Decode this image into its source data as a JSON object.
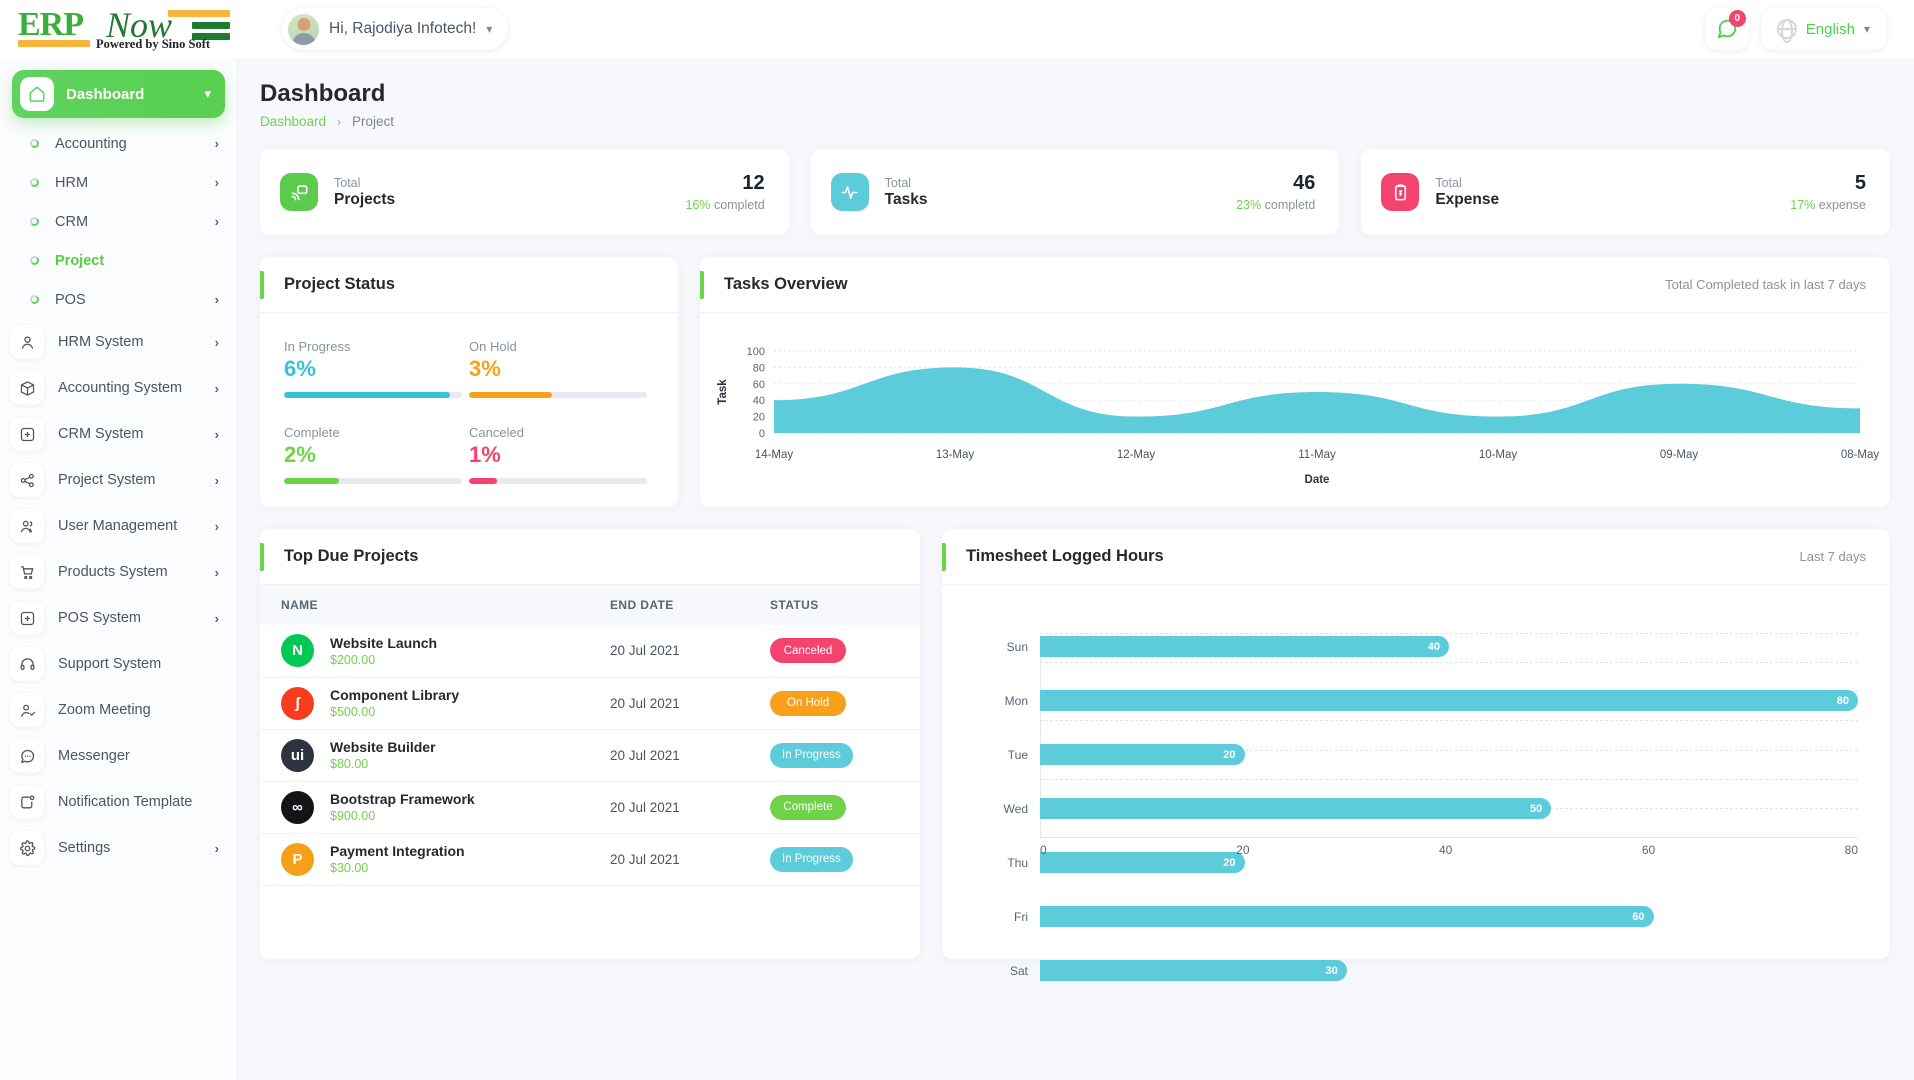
{
  "brand": {
    "erp": "ERP",
    "now": "Now",
    "tagline": "Powered by Sino Soft"
  },
  "topbar": {
    "greeting": "Hi, Rajodiya Infotech!",
    "chevron": "chevron-down",
    "message_badge": "0",
    "language": "English",
    "accent_green": "#4ad04a",
    "badge_color": "#f4436c"
  },
  "sidebar": {
    "dashboard": {
      "label": "Dashboard",
      "icon": "home-icon"
    },
    "sub_items": [
      {
        "label": "Accounting",
        "has_chevron": true,
        "active": false
      },
      {
        "label": "HRM",
        "has_chevron": true,
        "active": false
      },
      {
        "label": "CRM",
        "has_chevron": true,
        "active": false
      },
      {
        "label": "Project",
        "has_chevron": false,
        "active": true
      },
      {
        "label": "POS",
        "has_chevron": true,
        "active": false
      }
    ],
    "items": [
      {
        "label": "HRM System",
        "icon": "user-icon",
        "has_chevron": true
      },
      {
        "label": "Accounting System",
        "icon": "box-icon",
        "has_chevron": true
      },
      {
        "label": "CRM System",
        "icon": "crm-icon",
        "has_chevron": true
      },
      {
        "label": "Project System",
        "icon": "share-icon",
        "has_chevron": true
      },
      {
        "label": "User Management",
        "icon": "users-icon",
        "has_chevron": true
      },
      {
        "label": "Products System",
        "icon": "cart-icon",
        "has_chevron": true
      },
      {
        "label": "POS System",
        "icon": "pos-icon",
        "has_chevron": true
      },
      {
        "label": "Support System",
        "icon": "headset-icon",
        "has_chevron": false
      },
      {
        "label": "Zoom Meeting",
        "icon": "user-check-icon",
        "has_chevron": false
      },
      {
        "label": "Messenger",
        "icon": "chat-icon",
        "has_chevron": false
      },
      {
        "label": "Notification Template",
        "icon": "bell-box-icon",
        "has_chevron": false
      },
      {
        "label": "Settings",
        "icon": "gear-icon",
        "has_chevron": true
      }
    ]
  },
  "page": {
    "title": "Dashboard",
    "breadcrumb": {
      "root": "Dashboard",
      "separator": "›",
      "current": "Project"
    }
  },
  "stats": [
    {
      "total_label": "Total",
      "name": "Projects",
      "value": "12",
      "sub_pct": "16%",
      "sub_text": " completd",
      "color": "#5ccc4f",
      "icon": "cast-icon"
    },
    {
      "total_label": "Total",
      "name": "Tasks",
      "value": "46",
      "sub_pct": "23%",
      "sub_text": " completd",
      "color": "#5cccdb",
      "icon": "activity-icon"
    },
    {
      "total_label": "Total",
      "name": "Expense",
      "value": "5",
      "sub_pct": "17%",
      "sub_text": " expense",
      "color": "#f4436c",
      "icon": "clipboard-dollar-icon"
    }
  ],
  "project_status": {
    "title": "Project Status",
    "cells": [
      {
        "label": "In Progress",
        "pct": "6%",
        "value": 6,
        "color": "#35c4d7"
      },
      {
        "label": "On Hold",
        "pct": "3%",
        "value": 3,
        "color": "#f9a01b"
      },
      {
        "label": "Complete",
        "pct": "2%",
        "value": 2,
        "color": "#6fd34a"
      },
      {
        "label": "Canceled",
        "pct": "1%",
        "value": 1,
        "color": "#f4436c"
      }
    ]
  },
  "tasks_overview": {
    "title": "Tasks Overview",
    "note": "Total Completed task in last 7 days"
  },
  "top_due_projects": {
    "title": "Top Due Projects",
    "columns": [
      "NAME",
      "END DATE",
      "STATUS"
    ],
    "rows": [
      {
        "name": "Website Launch",
        "cost": "$200.00",
        "end_date": "20 Jul 2021",
        "status": "Canceled",
        "status_color": "#f4436c",
        "avatar_letter": "N",
        "avatar_color": "#00c853"
      },
      {
        "name": "Component Library",
        "cost": "$500.00",
        "end_date": "20 Jul 2021",
        "status": "On Hold",
        "status_color": "#f9a01b",
        "avatar_letter": "ʃ",
        "avatar_color": "#fa3c1e"
      },
      {
        "name": "Website Builder",
        "cost": "$80.00",
        "end_date": "20 Jul 2021",
        "status": "In Progress",
        "status_color": "#5cccdb",
        "avatar_letter": "ui",
        "avatar_color": "#2f3340"
      },
      {
        "name": "Bootstrap Framework",
        "cost": "$900.00",
        "end_date": "20 Jul 2021",
        "status": "Complete",
        "status_color": "#6fd34a",
        "avatar_letter": "∞",
        "avatar_color": "#121417"
      },
      {
        "name": "Payment Integration",
        "cost": "$30.00",
        "end_date": "20 Jul 2021",
        "status": "In Progress",
        "status_color": "#5cccdb",
        "avatar_letter": "P",
        "avatar_color": "#f6a01a"
      }
    ]
  },
  "timesheet": {
    "title": "Timesheet Logged Hours",
    "note": "Last 7 days"
  },
  "chart_data": [
    {
      "type": "area",
      "title": "Tasks Overview",
      "subtitle": "Total Completed task in last 7 days",
      "categories": [
        "14-May",
        "13-May",
        "12-May",
        "11-May",
        "10-May",
        "09-May",
        "08-May"
      ],
      "values": [
        40,
        80,
        20,
        50,
        20,
        60,
        30
      ],
      "xlabel": "Date",
      "ylabel": "Task",
      "ylim": [
        0,
        100
      ],
      "yticks": [
        0,
        20,
        40,
        60,
        80,
        100
      ],
      "grid": true,
      "series_color": "#5cccdb",
      "smooth": true
    },
    {
      "type": "bar",
      "orientation": "horizontal",
      "title": "Timesheet Logged Hours",
      "subtitle": "Last 7 days",
      "categories": [
        "Sun",
        "Mon",
        "Tue",
        "Wed",
        "Thu",
        "Fri",
        "Sat"
      ],
      "values": [
        40,
        80,
        20,
        50,
        20,
        60,
        30
      ],
      "xlabel": "",
      "ylabel": "",
      "xlim": [
        0,
        80
      ],
      "xticks": [
        0,
        20,
        40,
        60,
        80
      ],
      "grid": true,
      "bar_color": "#5cccdb",
      "data_labels": true
    }
  ]
}
